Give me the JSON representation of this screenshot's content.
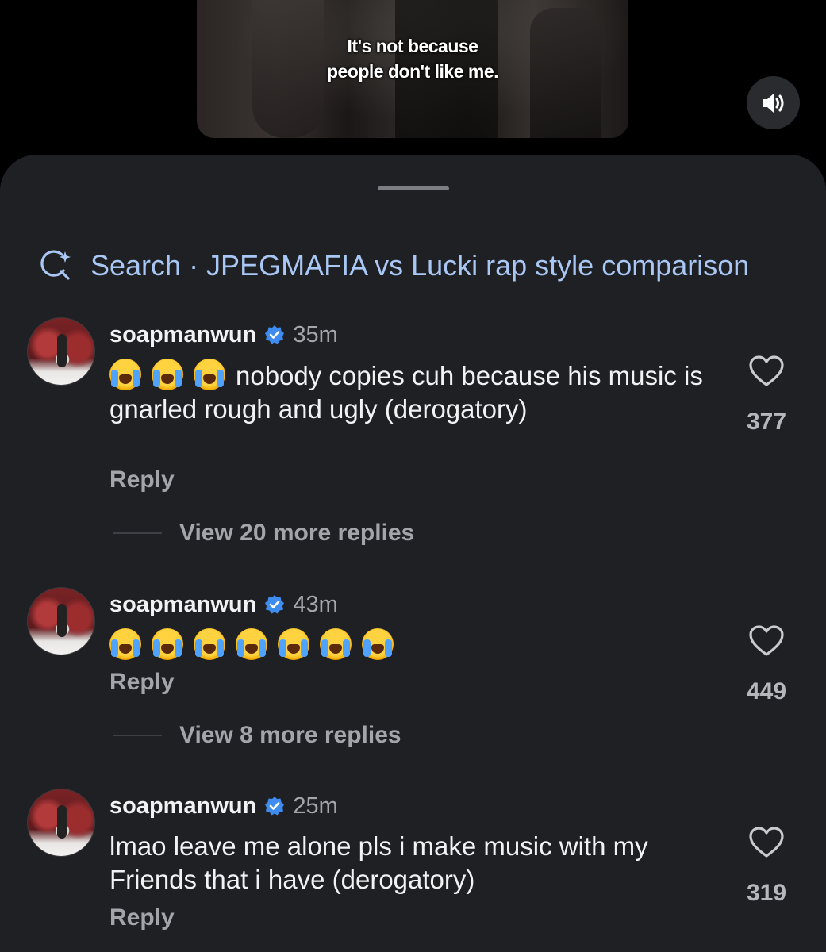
{
  "video": {
    "subtitle_line1": "It's not because",
    "subtitle_line2": "people don't like me.",
    "mute_icon": "speaker-icon"
  },
  "search": {
    "label": "Search · JPEGMAFIA vs Lucki rap style comparison",
    "icon": "sparkle-search-icon",
    "color": "#a9c7f4"
  },
  "comments": [
    {
      "username": "soapmanwun",
      "verified": true,
      "time": "35m",
      "emoji_count": 3,
      "emoji": "loudly-crying-face",
      "text": "nobody copies cuh because his music is gnarled rough and ugly (derogatory)",
      "likes": "377",
      "reply_label": "Reply",
      "view_replies": "View 20 more replies"
    },
    {
      "username": "soapmanwun",
      "verified": true,
      "time": "43m",
      "emoji_count": 7,
      "emoji": "loudly-crying-face",
      "text": "",
      "likes": "449",
      "reply_label": "Reply",
      "view_replies": "View 8 more replies"
    },
    {
      "username": "soapmanwun",
      "verified": true,
      "time": "25m",
      "emoji_count": 0,
      "text": "lmao leave me alone pls i make music with my Friends that i have (derogatory)",
      "likes": "319",
      "reply_label": "Reply"
    }
  ],
  "colors": {
    "sheet_bg": "#1f2024",
    "verified_blue": "#3f8cf0",
    "muted_text": "#a4a5aa"
  }
}
